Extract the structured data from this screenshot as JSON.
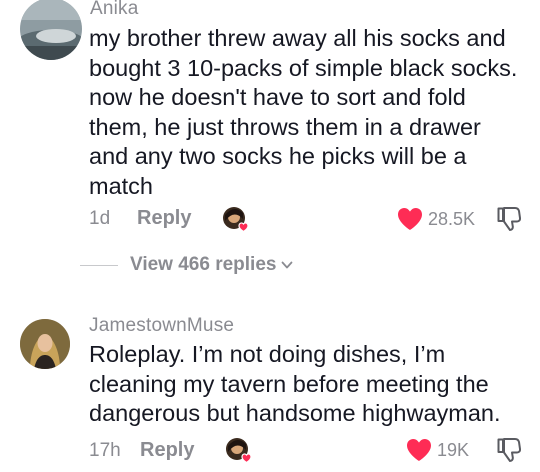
{
  "comments": [
    {
      "author": "Anika",
      "lines": [
        "my brother threw away all his socks and",
        "bought 3 10-packs of simple black socks.",
        "now he doesn't have to sort and fold",
        "them, he just throws them in a drawer",
        "and any two socks he picks will be a",
        "match"
      ],
      "time": "1d",
      "reply_label": "Reply",
      "likes": "28.5K",
      "liked": true,
      "replies_label": "View 466 replies"
    },
    {
      "author": "JamestownMuse",
      "lines": [
        "Roleplay. I’m not doing dishes, I’m",
        "cleaning my tavern before meeting the",
        "dangerous but handsome highwayman."
      ],
      "time": "17h",
      "reply_label": "Reply",
      "likes": "19K",
      "liked": true
    }
  ],
  "icons": {
    "like": "heart-icon",
    "dislike": "thumbs-down-icon",
    "creator_liked": "creator-liked-avatar-icon",
    "expand": "chevron-down-icon"
  },
  "colors": {
    "like_active": "#fe2c55",
    "secondary_text": "#8a8b91",
    "primary_text": "#161823"
  }
}
